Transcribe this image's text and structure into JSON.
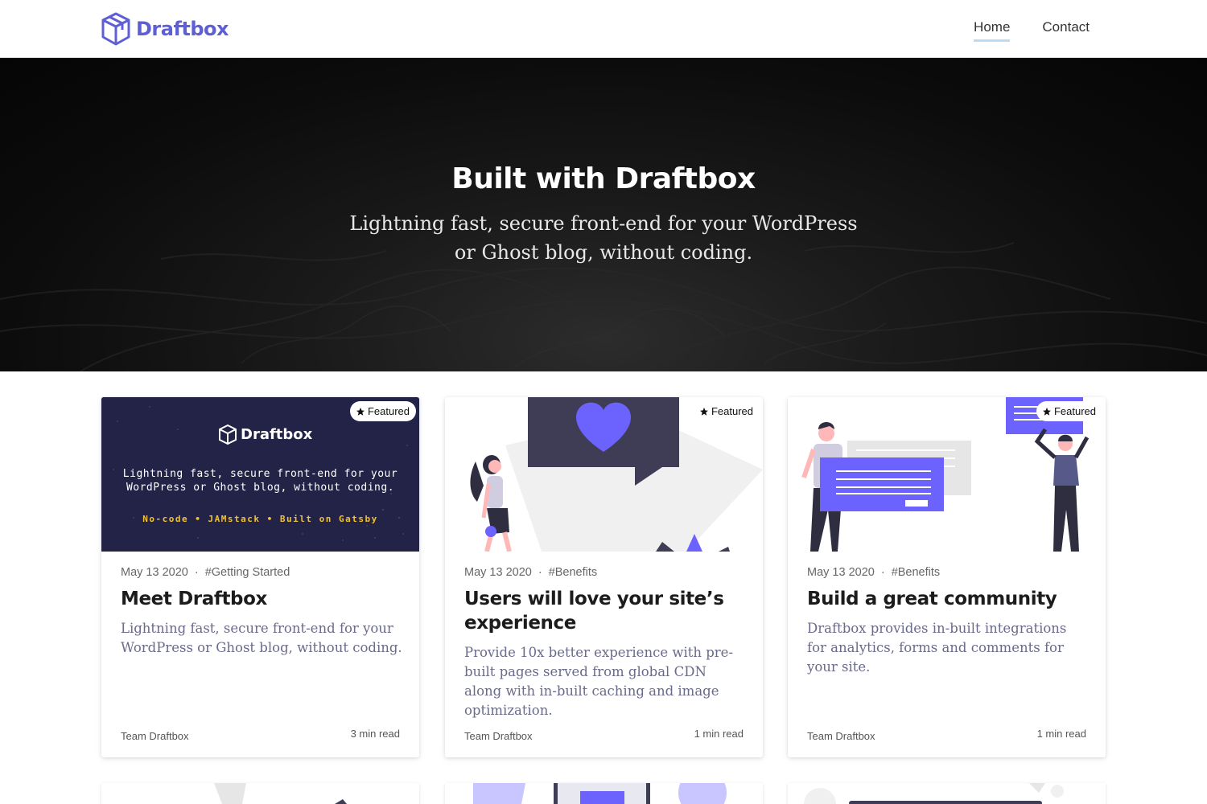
{
  "header": {
    "logo_text": "Draftbox",
    "nav": [
      {
        "label": "Home",
        "active": true
      },
      {
        "label": "Contact",
        "active": false
      }
    ]
  },
  "hero": {
    "title": "Built with Draftbox",
    "subtitle": "Lightning fast, secure front-end for your WordPress or Ghost blog, without coding."
  },
  "colors": {
    "brand": "#5f5fd5",
    "accent_purple": "#6c63ff",
    "nav_underline": "#b8dcf3",
    "hero_bg": "#0c0c0c"
  },
  "cards": [
    {
      "badge": "Featured",
      "date": "May 13 2020",
      "tag": "#Getting Started",
      "title": "Meet Draftbox",
      "excerpt": "Lightning fast, secure front-end for your WordPress or Ghost blog, without coding.",
      "author": "Team Draftbox",
      "read_time": "3 min read",
      "image": {
        "logo_text": "Draftbox",
        "line1": "Lightning fast, secure front-end for your",
        "line2": "WordPress or Ghost blog, without coding.",
        "tagline": "No-code • JAMstack • Built on Gatsby"
      }
    },
    {
      "badge": "Featured",
      "date": "May 13 2020",
      "tag": "#Benefits",
      "title": "Users will love your site’s experience",
      "excerpt": "Provide 10x better experience with pre-built pages served from global CDN along with in-built caching and image optimization.",
      "author": "Team Draftbox",
      "read_time": "1 min read"
    },
    {
      "badge": "Featured",
      "date": "May 13 2020",
      "tag": "#Benefits",
      "title": "Build a great community",
      "excerpt": "Draftbox provides in-built integrations for analytics, forms and comments for your site.",
      "author": "Team Draftbox",
      "read_time": "1 min read"
    }
  ],
  "icons": [
    "box-logo-icon",
    "star-icon",
    "heart-icon"
  ]
}
